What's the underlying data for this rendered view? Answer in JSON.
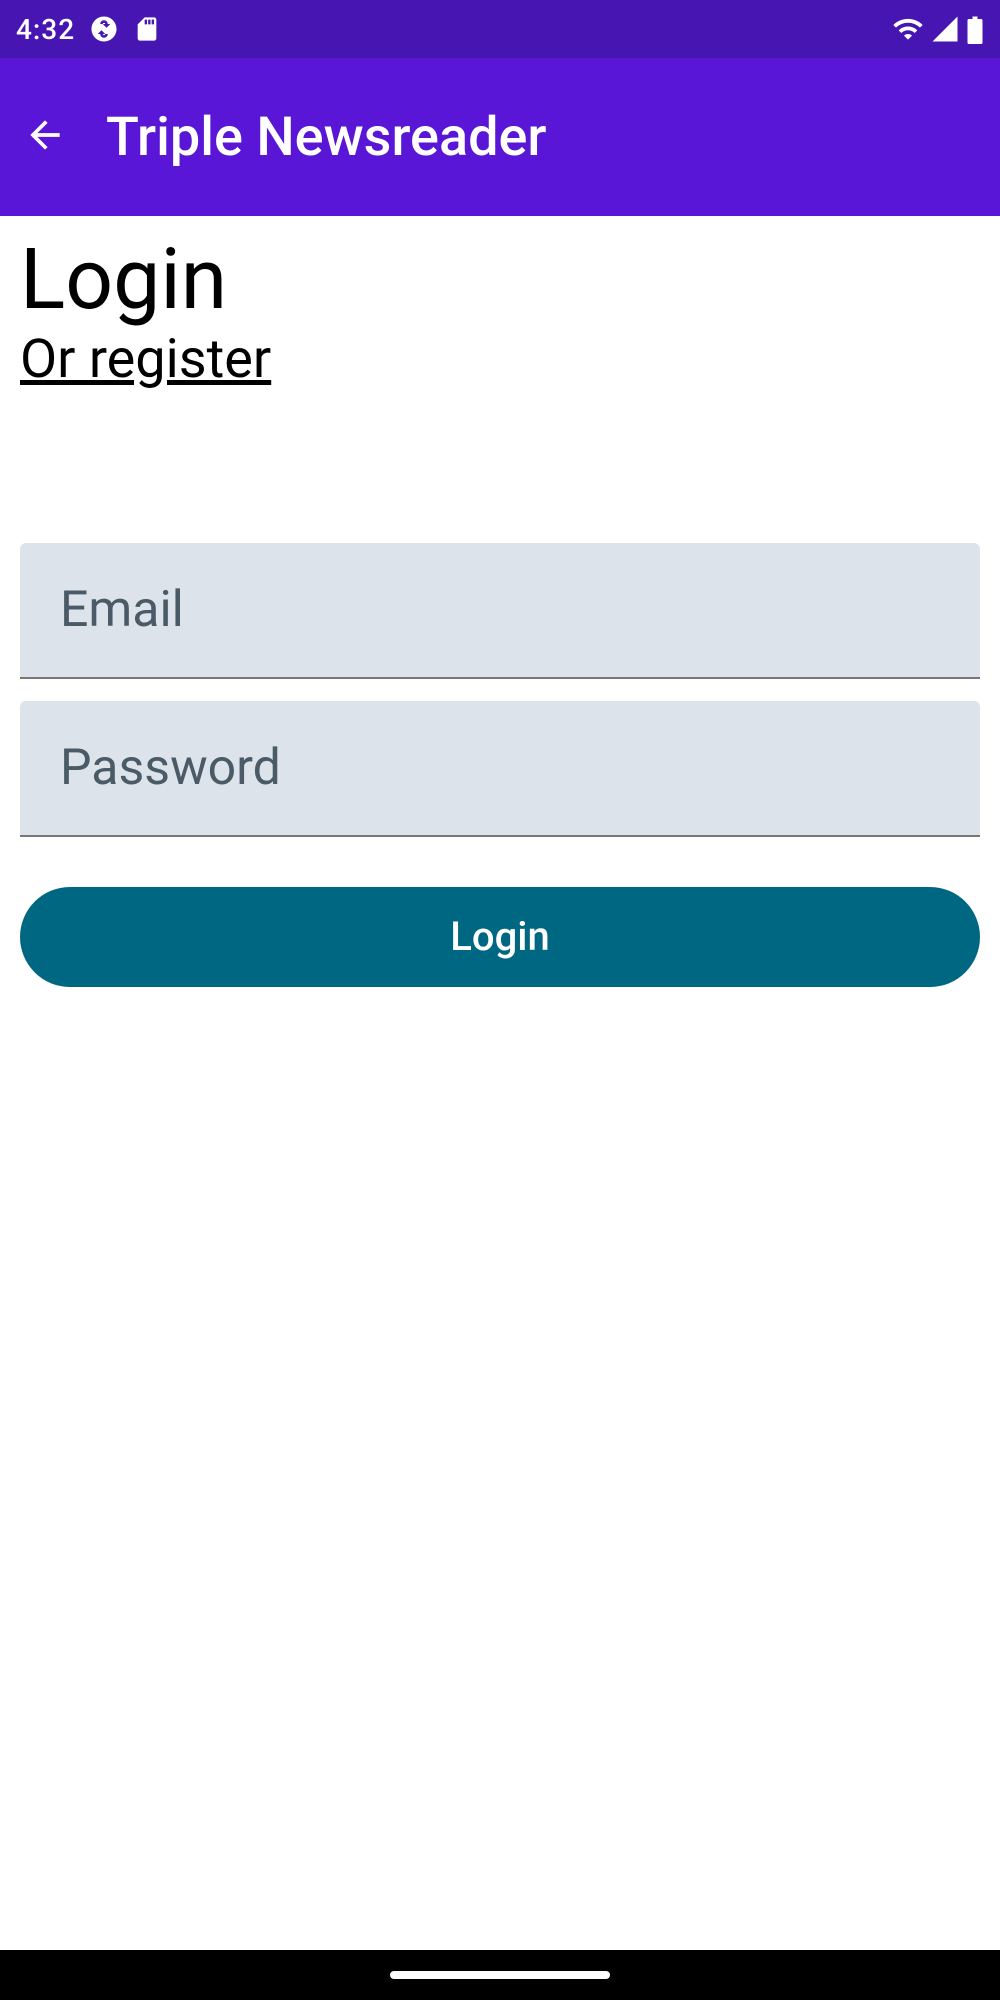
{
  "statusBar": {
    "time": "4:32"
  },
  "appBar": {
    "title": "Triple Newsreader"
  },
  "page": {
    "title": "Login",
    "registerLink": "Or register"
  },
  "form": {
    "emailPlaceholder": "Email",
    "passwordPlaceholder": "Password",
    "loginButton": "Login"
  },
  "colors": {
    "primary": "#5916d6",
    "primaryDark": "#4615b2",
    "accent": "#006782",
    "fieldBg": "#dde3ea"
  }
}
